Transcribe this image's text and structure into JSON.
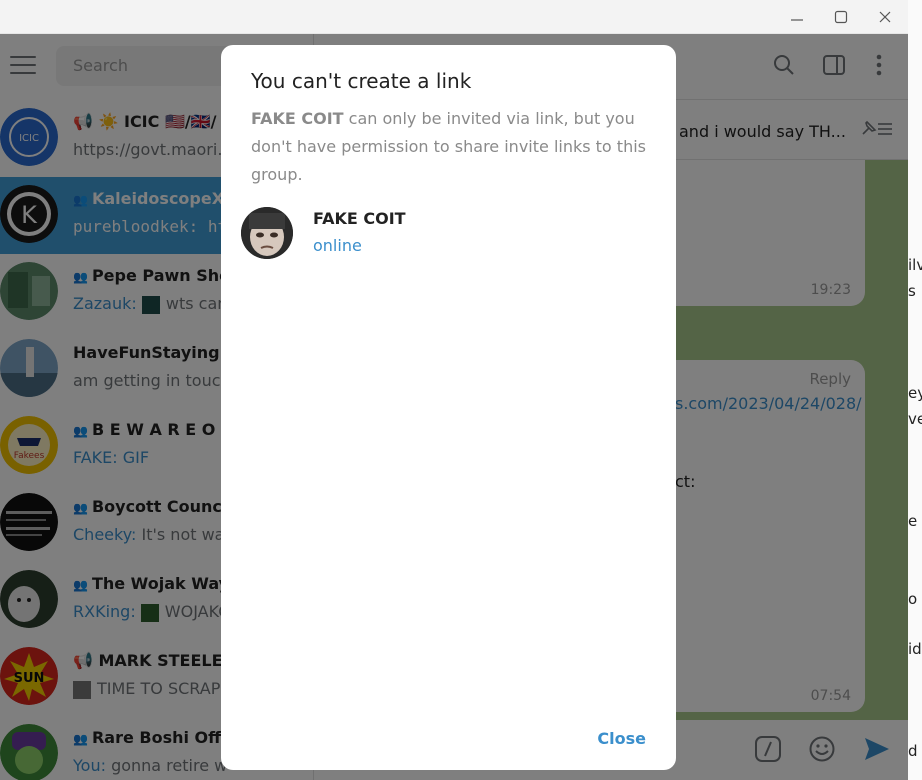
{
  "window": {
    "minimize": "—",
    "maximize": "☐",
    "close": "✕"
  },
  "sidebar": {
    "search_placeholder": "Search",
    "chats": [
      {
        "name": "📢 ☀️ ICIC 🇺🇸/🇬🇧/",
        "preview": "https://govt.maori.r",
        "sender": ""
      },
      {
        "name": "KaleidoscopeXC",
        "preview": "purebloodkek: htt",
        "sender": ""
      },
      {
        "name": "Pepe Pawn Shop",
        "preview": "wts cam",
        "sender": "Zazauk:"
      },
      {
        "name": "HaveFunStayingPo...",
        "preview": "am getting in touch",
        "sender": ""
      },
      {
        "name": "B E W A R E O F",
        "preview": "GIF",
        "sender": "FAKE:"
      },
      {
        "name": "Boycott Council",
        "preview": "It's not was",
        "sender": "Cheeky:"
      },
      {
        "name": "The Wojak Way",
        "preview": "WOJAKO",
        "sender": "RXKing:"
      },
      {
        "name": "📢 MARK STEELE CH",
        "preview": "TIME TO SCRAP T",
        "sender": ""
      },
      {
        "name": "Rare Boshi Offi...",
        "preview": "gonna retire w",
        "sender": "You:"
      }
    ]
  },
  "chat": {
    "pinned_text": "and i would say TH...",
    "bubble1_time": "19:23",
    "bubble2_reply": "Reply",
    "bubble2_link": "s.com/2023/04/24/028/",
    "bubble2_text": "ct:",
    "bubble2_time": "07:54"
  },
  "background_right": {
    "line1": "ilv",
    "line2": "s",
    "line3": "ey",
    "line4": "ve",
    "line5": "e c",
    "line6": "o",
    "line7": "id",
    "line8": "d"
  },
  "modal": {
    "title": "You can't create a link",
    "group_name": "FAKE COIT",
    "message": " can only be invited via link, but you don't have permission to share invite links to this group.",
    "user_name": "FAKE COIT",
    "user_status": "online",
    "close_label": "Close"
  },
  "colors": {
    "accent": "#3b8fcc",
    "active_chat": "#419fd9",
    "chat_bg": "#a9c98c"
  }
}
